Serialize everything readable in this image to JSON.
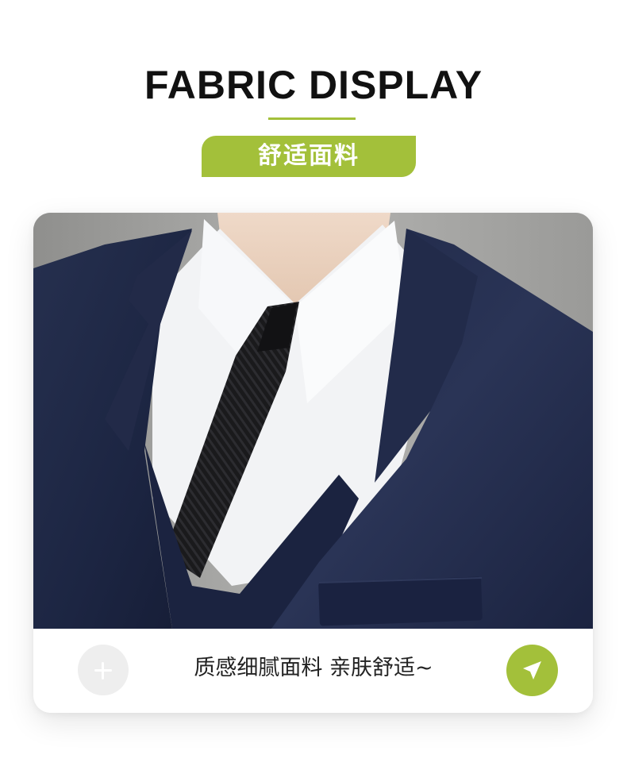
{
  "header": {
    "title": "FABRIC DISPLAY",
    "badge": "舒适面料"
  },
  "card": {
    "photo_alt": "suit-jacket-closeup",
    "caption": "质感细腻面料 亲肤舒适~"
  },
  "icons": {
    "add": "plus-icon",
    "send": "send-arrow-icon"
  },
  "colors": {
    "accent": "#a3c03a",
    "title": "#111111",
    "suit_navy": "#1f2a48"
  }
}
